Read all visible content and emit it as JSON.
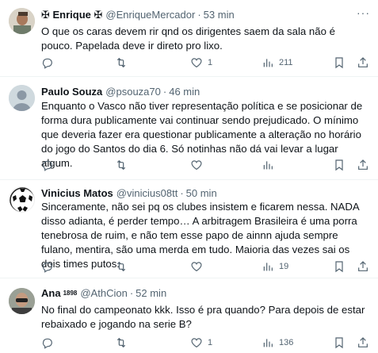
{
  "tweets": [
    {
      "name": "✠ Enrique ✠",
      "handle": "@EnriqueMercador",
      "time": "53 min",
      "text": "O que os caras devem rir qnd os dirigentes saem da sala não é pouco. Papelada deve ir direto pro lixo.",
      "replies": "",
      "retweets": "",
      "likes": "1",
      "views": "211",
      "avatar_icon": "photo-avatar"
    },
    {
      "name": "Paulo Souza",
      "handle": "@psouza70",
      "time": "46 min",
      "text": "Enquanto o Vasco não tiver representação política e se posicionar de forma dura publicamente vai continuar sendo prejudicado. O mínimo que deveria fazer era questionar publicamente a alteração no horário do jogo do Santos do dia 6. Só notinhas não dá vai levar a lugar algum.",
      "replies": "",
      "retweets": "",
      "likes": "",
      "views": "",
      "avatar_icon": "default-person-avatar"
    },
    {
      "name": "Vinicius Matos",
      "handle": "@vinicius08tt",
      "time": "50 min",
      "text": "Sinceramente, não sei pq os clubes insistem e ficarem nessa. NADA disso adianta, é perder tempo… A arbitragem Brasileira é uma porra tenebrosa de ruim, e não tem esse papo de ainnn ajuda sempre fulano, mentira, são uma merda em tudo. Maioria das vezes sai os dois times putos.",
      "replies": "",
      "retweets": "",
      "likes": "",
      "views": "19",
      "avatar_icon": "soccer-ball-avatar"
    },
    {
      "name": "Ana",
      "name_suffix": "1898",
      "handle": "@AthCion",
      "time": "52 min",
      "text": "No final do campeonato kkk. Isso é pra quando? Para depois de estar rebaixado e jogando na serie B?",
      "replies": "",
      "retweets": "",
      "likes": "1",
      "views": "136",
      "avatar_icon": "photo-avatar"
    }
  ],
  "more_label": "···",
  "dot": "·"
}
